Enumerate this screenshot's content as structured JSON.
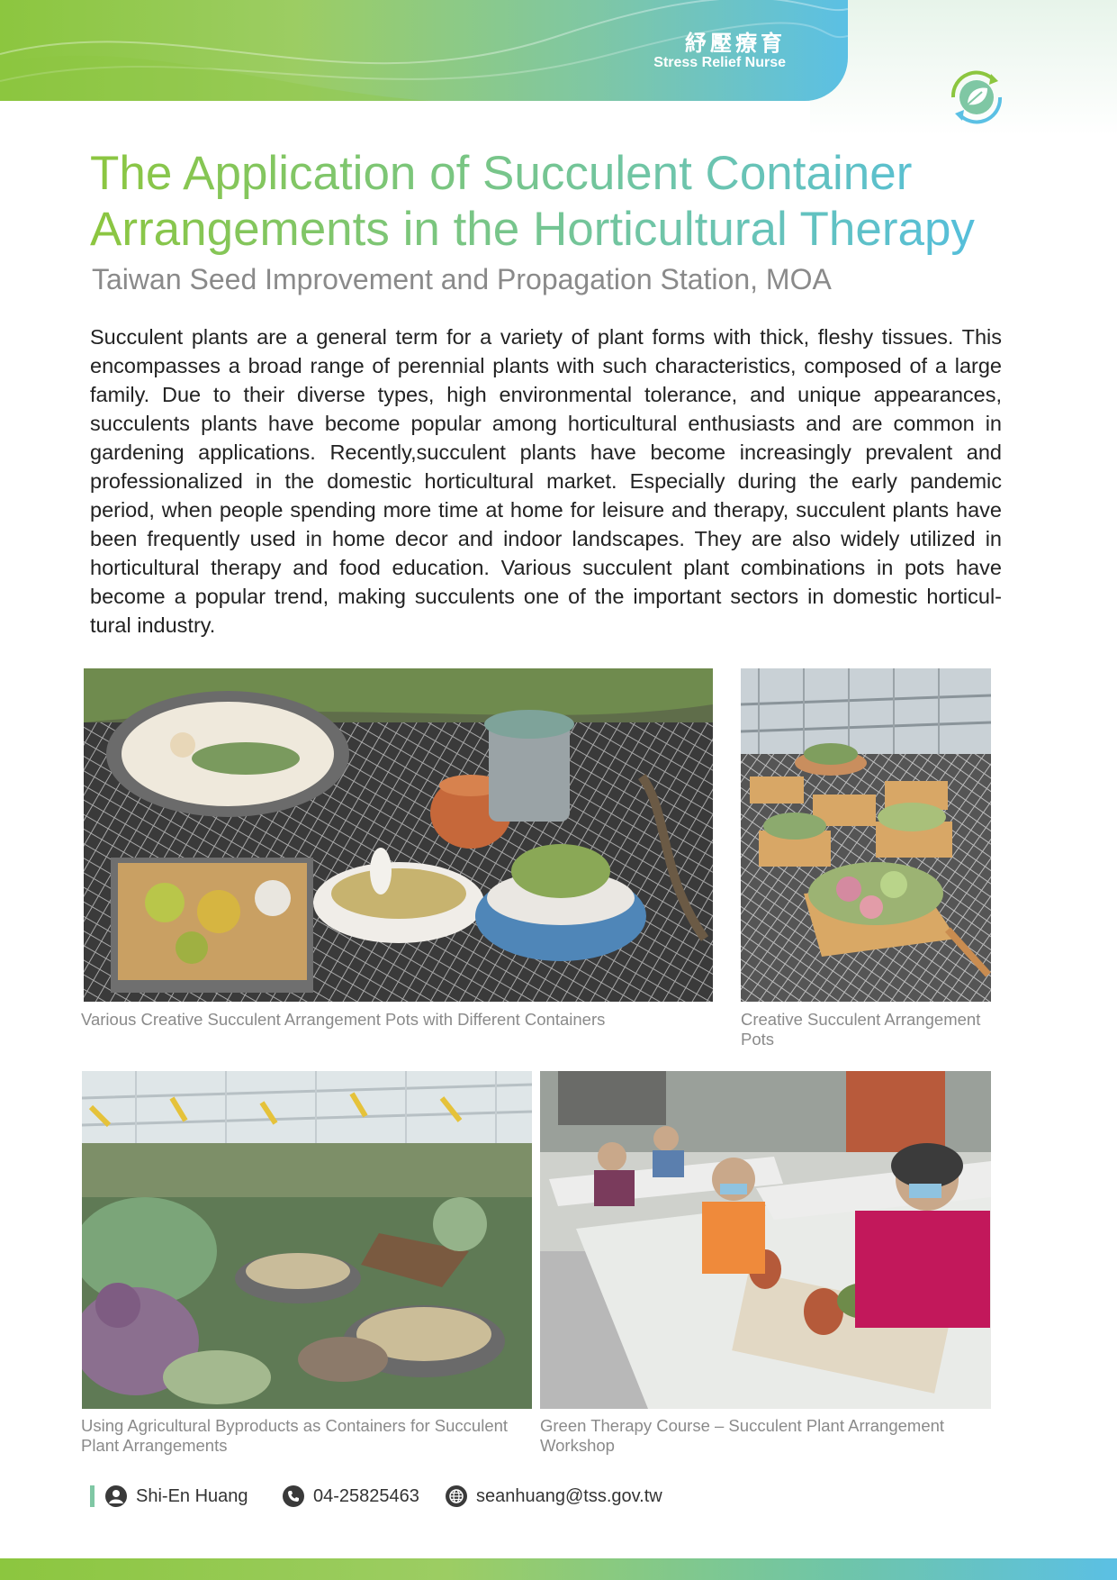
{
  "header": {
    "title_cn": "紓壓療育",
    "title_en": "Stress Relief Nurse",
    "logo_icon": "leaf-recycle-icon"
  },
  "article": {
    "title": "The Application of Succulent Container Arrangements in the Horticultural Therapy",
    "subtitle": "Taiwan Seed Improvement and Propagation Station, MOA",
    "body": "Succulent plants are a general term for a variety of plant forms with thick, fleshy tissues. This encompasses a broad range of perennial plants with such characteristics, composed of a large family. Due to their diverse types, high environmental tolerance, and unique appearances, succulents plants have become popular among horticultural enthusiasts and are common in gardening applications. Recently,succulent plants have become increasingly prevalent and professionalized in the domestic horticultural market. Especially during the early pandemic period, when people spending more time at home for leisure and therapy, succulent plants have been frequently used in home decor and indoor landscapes. They are also widely utilized in horticultural therapy and food education. Various succulent  plant combinations in pots have become a popular trend, making succulents one of the important sectors in domestic horticul-tural industry."
  },
  "figures": [
    {
      "caption": "Various Creative Succulent Arrangement Pots with Different Containers"
    },
    {
      "caption": "Creative Succulent Arrangement Pots"
    },
    {
      "caption": "Using Agricultural Byproducts as Containers for Succulent Plant Arrangements"
    },
    {
      "caption": "Green Therapy Course – Succulent Plant Arrangement Workshop"
    }
  ],
  "contact": {
    "name": "Shi-En Huang",
    "phone": "04-25825463",
    "email": "seanhuang@tss.gov.tw",
    "icons": [
      "person-icon",
      "phone-icon",
      "globe-icon"
    ]
  },
  "colors": {
    "green": "#8cc63f",
    "teal": "#6fc5a8",
    "blue": "#5bc0e4",
    "caption_gray": "#8a8a8a"
  }
}
